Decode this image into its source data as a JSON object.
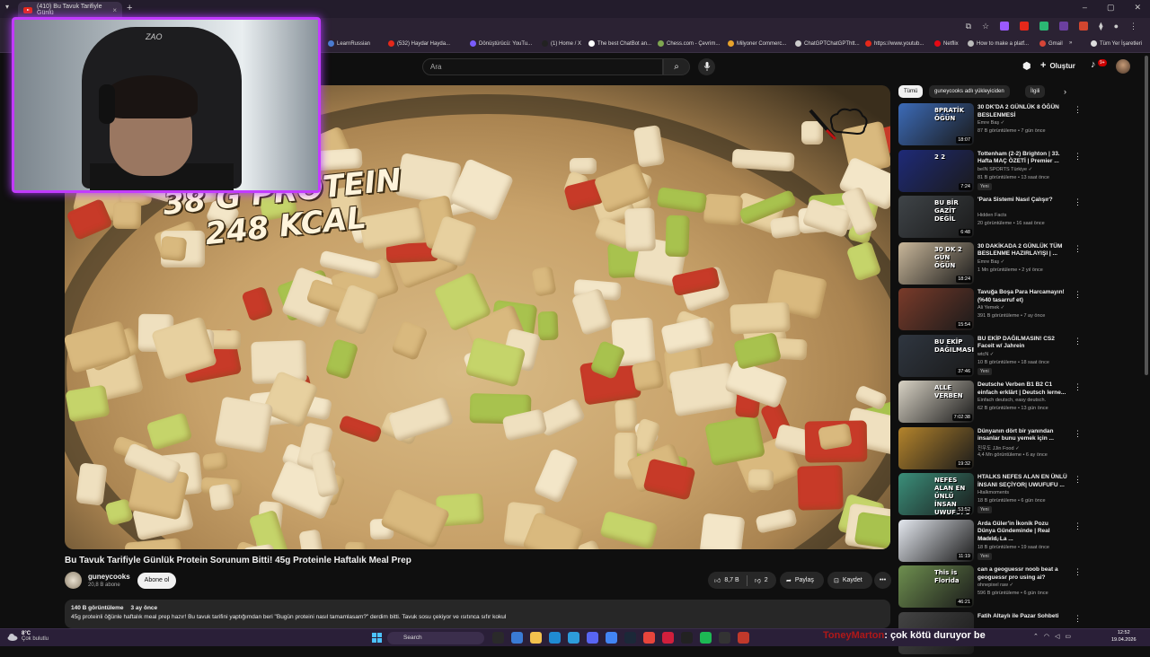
{
  "browser": {
    "tab_title": "(410) Bu Tavuk Tarifiyle Günlü",
    "new_tab": "+",
    "close": "×",
    "window_controls": [
      "–",
      "▢",
      "✕"
    ],
    "bookmarks": [
      {
        "label": "LearnRussian",
        "color": "#4a7bd0"
      },
      {
        "label": "(532) Haydar Hayda...",
        "color": "#e5281a"
      },
      {
        "label": "Dönüştürücü: YouTu...",
        "color": "#7a5cff"
      },
      {
        "label": "(1) Home / X",
        "color": "#222222"
      },
      {
        "label": "The best ChatBot an...",
        "color": "#ffffff"
      },
      {
        "label": "Chess.com - Çevrim...",
        "color": "#7fa650"
      },
      {
        "label": "Milyoner Commerc...",
        "color": "#e8a22b"
      },
      {
        "label": "ChatGPTChatGPThtt...",
        "color": "#cccccc"
      },
      {
        "label": "https://www.youtub...",
        "color": "#e5281a"
      },
      {
        "label": "Netflix",
        "color": "#e50914"
      },
      {
        "label": "How to make a platf...",
        "color": "#bbbbbb"
      },
      {
        "label": "Gmail",
        "color": "#d64537"
      },
      {
        "label": "»",
        "color": ""
      },
      {
        "label": "Tüm Yer İşaretleri",
        "color": "#dddddd"
      }
    ]
  },
  "masthead": {
    "search_placeholder": "Ara",
    "create_label": "Oluştur",
    "notif_count": "9+"
  },
  "video": {
    "overlay_line1": "38 G PROTEIN",
    "overlay_line2": "248 KCAL",
    "title": "Bu Tavuk Tarifiyle Günlük Protein Sorunum Bitti! 45g Proteinle Haftalık Meal Prep",
    "channel": "guneycooks",
    "subscribers": "20,8 B abone",
    "subscribe_label": "Abone ol",
    "likes": "8,7 B",
    "comments_short": "2",
    "share_label": "Paylaş",
    "save_label": "Kaydet",
    "more": "•••",
    "views": "140 B görüntüleme",
    "age": "3 ay önce",
    "description": "45g proteinli öğünle haftalık meal prep hazır! Bu tavuk tarifini yaptığımdan beri \"Bugün proteini nasıl tamamlasam?\" derdim bitti. Tavuk sosu çekiyor ve ısıtınca sıfır kokul"
  },
  "chips": [
    "Tümü",
    "guneycooks adlı yükleyiciden",
    "İlgili"
  ],
  "recommendations": [
    {
      "title": "30 DK'DA 2 GÜNLÜK 8 ÖĞÜN BESLENMESİ",
      "channel": "Emre Baş ✓",
      "meta": "87 B görüntüleme • 7 gün önce",
      "duration": "18:07",
      "new": "",
      "thumb_text": "8PRATİK ÖĞÜN",
      "bg": "#3c6bb8"
    },
    {
      "title": "Tottenham (2-2) Brighton | 33. Hafta MAÇ ÖZETİ | Premier ...",
      "channel": "beIN SPORTS Türkiye ✓",
      "meta": "81 B görüntüleme • 13 saat önce",
      "duration": "7:24",
      "new": "Yeni",
      "thumb_text": "2 2",
      "bg": "#1e2a78"
    },
    {
      "title": "'Para Sistemi Nasıl Çalışır?",
      "channel": "Hidden Facts",
      "meta": "20 görüntüleme • 16 saat önce",
      "duration": "6:48",
      "new": "",
      "thumb_text": "BU BİR GAZİT DEĞİL",
      "bg": "#3f4448"
    },
    {
      "title": "30 DAKİKADA 2 GÜNLÜK TÜM BESLENME HAZIRLAYIŞI | ...",
      "channel": "Emre Baş ✓",
      "meta": "1 Mn görüntüleme • 2 yıl önce",
      "duration": "18:24",
      "new": "",
      "thumb_text": "30 DK 2 GÜN ÖĞÜN",
      "bg": "#c9b79a"
    },
    {
      "title": "Tavuğa Boşa Para Harcamayın! (%40 tasarruf et)",
      "channel": "Ali Yemek ✓",
      "meta": "391 B görüntüleme • 7 ay önce",
      "duration": "15:54",
      "new": "",
      "thumb_text": "",
      "bg": "#7a3b2a"
    },
    {
      "title": "BU EKİP DAĞILMASIN! CS2 Faceit w/ Jahrein",
      "channel": "wtcN ✓",
      "meta": "10 B görüntüleme • 18 saat önce",
      "duration": "37:46",
      "new": "Yeni",
      "thumb_text": "BU EKİP DAĞILMASIN",
      "bg": "#2f3640"
    },
    {
      "title": "Deutsche Verben B1 B2 C1 einfach erklärt | Deutsch lerne...",
      "channel": "Einfach deutsch, easy deutsch.",
      "meta": "62 B görüntüleme • 13 gün önce",
      "duration": "7:02:38",
      "new": "",
      "thumb_text": "ALLE VERBEN",
      "bg": "#d8d2c4"
    },
    {
      "title": "Dünyanın dört bir yanından insanlar bunu yemek için ...",
      "channel": "진우도 JJin Food ✓",
      "meta": "4,4 Mn görüntüleme • 6 ay önce",
      "duration": "19:32",
      "new": "",
      "thumb_text": "",
      "bg": "#b4842c"
    },
    {
      "title": "HTALKS NEFES ALAN EN ÜNLÜ İNSANI SEÇİYOR| UWUFUFU ...",
      "channel": "Htalkmoments",
      "meta": "18 B görüntüleme • 6 gün önce",
      "duration": "53:52",
      "new": "Yeni",
      "thumb_text": "NEFES ALAN EN ÜNLÜ İNSAN UWUFUFU",
      "bg": "#3b8f7a"
    },
    {
      "title": "Arda Güler'in İkonik Pozu Dünya Gündeminde | Real Madrid, La ...",
      "channel": "Saltındiho",
      "meta": "18 B görüntüleme • 19 saat önce",
      "duration": "11:19",
      "new": "Yeni",
      "thumb_text": "",
      "bg": "#e4e8ef"
    },
    {
      "title": "can a geoguessr noob beat a geoguessr pro using ai?",
      "channel": "ohnepixel raw ✓",
      "meta": "596 B görüntüleme • 6 gün önce",
      "duration": "46:21",
      "new": "",
      "thumb_text": "This is Florida",
      "bg": "#6e8f4f"
    },
    {
      "title": "Fatih Altaylı ile Pazar Sohbeti",
      "channel": "",
      "meta": "",
      "duration": "",
      "new": "",
      "thumb_text": "",
      "bg": "#444444"
    }
  ],
  "taskbar": {
    "temp": "8°C",
    "weather": "Çok bulutlu",
    "search": "Search",
    "chat_user": "ToneyMarton",
    "chat_message": ": çok kötü duruyor be",
    "time": "12:52",
    "date": "19.04.2026"
  },
  "icons": {
    "search": "⌕",
    "mic": "🎙",
    "bell": "🔔",
    "create": "+"
  }
}
